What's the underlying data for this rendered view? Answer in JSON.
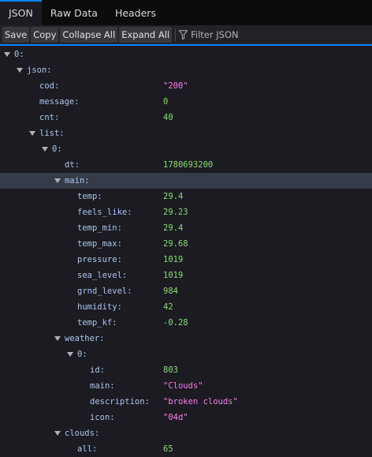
{
  "tabs": [
    {
      "label": "JSON",
      "active": true
    },
    {
      "label": "Raw Data",
      "active": false
    },
    {
      "label": "Headers",
      "active": false
    }
  ],
  "toolbar": {
    "save": "Save",
    "copy": "Copy",
    "collapse_all": "Collapse All",
    "expand_all": "Expand All",
    "filter_placeholder": "Filter JSON"
  },
  "colors": {
    "accent": "#0a84ff",
    "number": "#86de74",
    "string": "#ff7de9",
    "key": "#a9c6ee",
    "selected_row": "#353b48"
  },
  "rows": [
    {
      "key": "0:",
      "value": "",
      "type": "",
      "level": 0,
      "expanded": true,
      "selected": false
    },
    {
      "key": "json:",
      "value": "",
      "type": "",
      "level": 1,
      "expanded": true,
      "selected": false
    },
    {
      "key": "cod:",
      "value": "\"200\"",
      "type": "str",
      "level": 2,
      "expanded": null,
      "selected": false
    },
    {
      "key": "message:",
      "value": "0",
      "type": "num",
      "level": 2,
      "expanded": null,
      "selected": false
    },
    {
      "key": "cnt:",
      "value": "40",
      "type": "num",
      "level": 2,
      "expanded": null,
      "selected": false
    },
    {
      "key": "list:",
      "value": "",
      "type": "",
      "level": 2,
      "expanded": true,
      "selected": false
    },
    {
      "key": "0:",
      "value": "",
      "type": "",
      "level": 3,
      "expanded": true,
      "selected": false
    },
    {
      "key": "dt:",
      "value": "1780693200",
      "type": "num",
      "level": 4,
      "expanded": null,
      "selected": false
    },
    {
      "key": "main:",
      "value": "",
      "type": "",
      "level": 4,
      "expanded": true,
      "selected": true
    },
    {
      "key": "temp:",
      "value": "29.4",
      "type": "num",
      "level": 5,
      "expanded": null,
      "selected": false
    },
    {
      "key": "feels_like:",
      "value": "29.23",
      "type": "num",
      "level": 5,
      "expanded": null,
      "selected": false
    },
    {
      "key": "temp_min:",
      "value": "29.4",
      "type": "num",
      "level": 5,
      "expanded": null,
      "selected": false
    },
    {
      "key": "temp_max:",
      "value": "29.68",
      "type": "num",
      "level": 5,
      "expanded": null,
      "selected": false
    },
    {
      "key": "pressure:",
      "value": "1019",
      "type": "num",
      "level": 5,
      "expanded": null,
      "selected": false
    },
    {
      "key": "sea_level:",
      "value": "1019",
      "type": "num",
      "level": 5,
      "expanded": null,
      "selected": false
    },
    {
      "key": "grnd_level:",
      "value": "984",
      "type": "num",
      "level": 5,
      "expanded": null,
      "selected": false
    },
    {
      "key": "humidity:",
      "value": "42",
      "type": "num",
      "level": 5,
      "expanded": null,
      "selected": false
    },
    {
      "key": "temp_kf:",
      "value": "-0.28",
      "type": "num",
      "level": 5,
      "expanded": null,
      "selected": false
    },
    {
      "key": "weather:",
      "value": "",
      "type": "",
      "level": 4,
      "expanded": true,
      "selected": false
    },
    {
      "key": "0:",
      "value": "",
      "type": "",
      "level": 5,
      "expanded": true,
      "selected": false
    },
    {
      "key": "id:",
      "value": "803",
      "type": "num",
      "level": 6,
      "expanded": null,
      "selected": false
    },
    {
      "key": "main:",
      "value": "\"Clouds\"",
      "type": "str",
      "level": 6,
      "expanded": null,
      "selected": false
    },
    {
      "key": "description:",
      "value": "\"broken clouds\"",
      "type": "str",
      "level": 6,
      "expanded": null,
      "selected": false
    },
    {
      "key": "icon:",
      "value": "\"04d\"",
      "type": "str",
      "level": 6,
      "expanded": null,
      "selected": false
    },
    {
      "key": "clouds:",
      "value": "",
      "type": "",
      "level": 4,
      "expanded": true,
      "selected": false
    },
    {
      "key": "all:",
      "value": "65",
      "type": "num",
      "level": 5,
      "expanded": null,
      "selected": false
    }
  ]
}
